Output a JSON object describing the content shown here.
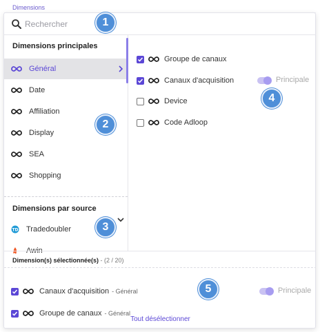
{
  "top_label": "Dimensions",
  "search": {
    "placeholder": "Rechercher"
  },
  "principal": {
    "title": "Dimensions principales",
    "items": [
      {
        "label": "Général",
        "active": true
      },
      {
        "label": "Date"
      },
      {
        "label": "Affiliation"
      },
      {
        "label": "Display"
      },
      {
        "label": "SEA"
      },
      {
        "label": "Shopping"
      }
    ]
  },
  "sources": {
    "title": "Dimensions par source",
    "items": [
      {
        "label": "Tradedoubler",
        "logo": "tradedoubler-logo"
      },
      {
        "label": "Awin",
        "logo": "awin-logo"
      }
    ]
  },
  "general_dims": [
    {
      "label": "Groupe de canaux",
      "checked": true
    },
    {
      "label": "Canaux d'acquisition",
      "checked": true,
      "toggle": "Principale"
    },
    {
      "label": "Device",
      "checked": false
    },
    {
      "label": "Code Adloop",
      "checked": false
    }
  ],
  "selected": {
    "title": "Dimension(s) sélectionnée(s)",
    "count": " - (2 / 20)",
    "rows": [
      {
        "label": "Canaux d'acquisition",
        "suffix": "- Général",
        "toggle": "Principale"
      },
      {
        "label": "Groupe de canaux",
        "suffix": "- Général"
      }
    ],
    "deselect_all": "Tout désélectionner"
  },
  "badges": [
    "1",
    "2",
    "3",
    "4",
    "5"
  ],
  "colors": {
    "accent": "#5b47d6",
    "badge": "#4f8fd8",
    "toggle": "#c9c2f2"
  }
}
